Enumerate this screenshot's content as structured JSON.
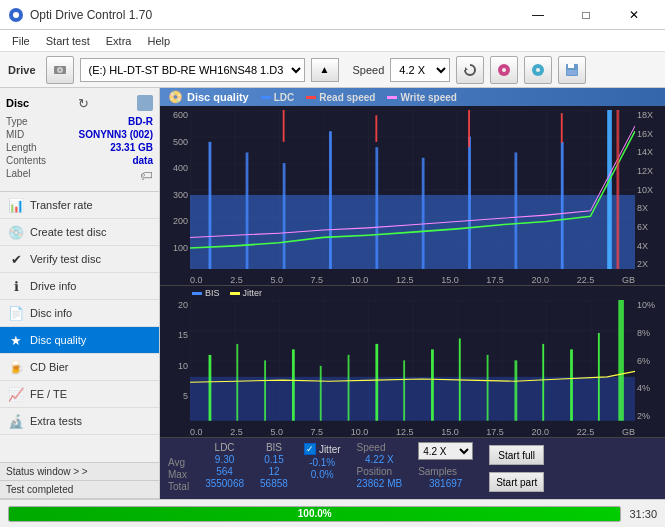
{
  "window": {
    "title": "Opti Drive Control 1.70",
    "controls": {
      "minimize": "—",
      "maximize": "□",
      "close": "✕"
    }
  },
  "menubar": {
    "items": [
      "File",
      "Start test",
      "Extra",
      "Help"
    ]
  },
  "drive_bar": {
    "label": "Drive",
    "drive_value": "(E:) HL-DT-ST BD-RE  WH16NS48 1.D3",
    "speed_label": "Speed",
    "speed_value": "4.2 X"
  },
  "disc": {
    "title": "Disc",
    "type_label": "Type",
    "type_value": "BD-R",
    "mid_label": "MID",
    "mid_value": "SONYNN3 (002)",
    "length_label": "Length",
    "length_value": "23.31 GB",
    "contents_label": "Contents",
    "contents_value": "data",
    "label_label": "Label"
  },
  "nav": {
    "items": [
      {
        "id": "transfer-rate",
        "label": "Transfer rate",
        "icon": "📊"
      },
      {
        "id": "create-test-disc",
        "label": "Create test disc",
        "icon": "💿"
      },
      {
        "id": "verify-test-disc",
        "label": "Verify test disc",
        "icon": "✔"
      },
      {
        "id": "drive-info",
        "label": "Drive info",
        "icon": "ℹ"
      },
      {
        "id": "disc-info",
        "label": "Disc info",
        "icon": "📄"
      },
      {
        "id": "disc-quality",
        "label": "Disc quality",
        "icon": "★",
        "active": true
      },
      {
        "id": "cd-bier",
        "label": "CD Bier",
        "icon": "🍺"
      },
      {
        "id": "fe-te",
        "label": "FE / TE",
        "icon": "📈"
      },
      {
        "id": "extra-tests",
        "label": "Extra tests",
        "icon": "🔬"
      }
    ]
  },
  "sidebar_status": {
    "status_window_label": "Status window > >",
    "completed_label": "Test completed"
  },
  "chart": {
    "title": "Disc quality",
    "legend": [
      {
        "id": "ldc",
        "label": "LDC",
        "color": "#4488ff"
      },
      {
        "id": "read-speed",
        "label": "Read speed",
        "color": "#ff4444"
      },
      {
        "id": "write-speed",
        "label": "Write speed",
        "color": "#ff88ff"
      }
    ],
    "legend2": [
      {
        "id": "bis",
        "label": "BIS",
        "color": "#4488ff"
      },
      {
        "id": "jitter",
        "label": "Jitter",
        "color": "#ffff44"
      }
    ],
    "upper_y_max": 600,
    "upper_y_labels": [
      "600",
      "500",
      "400",
      "300",
      "200",
      "100"
    ],
    "upper_y_right": [
      "18X",
      "16X",
      "14X",
      "12X",
      "10X",
      "8X",
      "6X",
      "4X",
      "2X"
    ],
    "lower_y_max": 20,
    "lower_y_labels": [
      "20",
      "15",
      "10",
      "5"
    ],
    "lower_y_right": [
      "10%",
      "8%",
      "6%",
      "4%",
      "2%"
    ],
    "x_labels": [
      "0.0",
      "2.5",
      "5.0",
      "7.5",
      "10.0",
      "12.5",
      "15.0",
      "17.5",
      "20.0",
      "22.5"
    ],
    "x_unit": "GB"
  },
  "stats": {
    "columns": [
      {
        "header": "LDC",
        "avg": "9.30",
        "max": "564",
        "total": "3550068"
      },
      {
        "header": "BIS",
        "avg": "0.15",
        "max": "12",
        "total": "56858"
      }
    ],
    "jitter": {
      "label": "Jitter",
      "avg": "-0.1%",
      "max": "0.0%",
      "checked": true
    },
    "speed": {
      "label": "Speed",
      "value": "4.22 X"
    },
    "speed_select": "4.2 X",
    "position": {
      "label": "Position",
      "value": "23862 MB"
    },
    "samples": {
      "label": "Samples",
      "value": "381697"
    },
    "buttons": {
      "start_full": "Start full",
      "start_part": "Start part"
    },
    "row_labels": {
      "avg": "Avg",
      "max": "Max",
      "total": "Total"
    }
  },
  "progress": {
    "percent": "100.0%",
    "fill_width": "100",
    "time": "31:30"
  }
}
